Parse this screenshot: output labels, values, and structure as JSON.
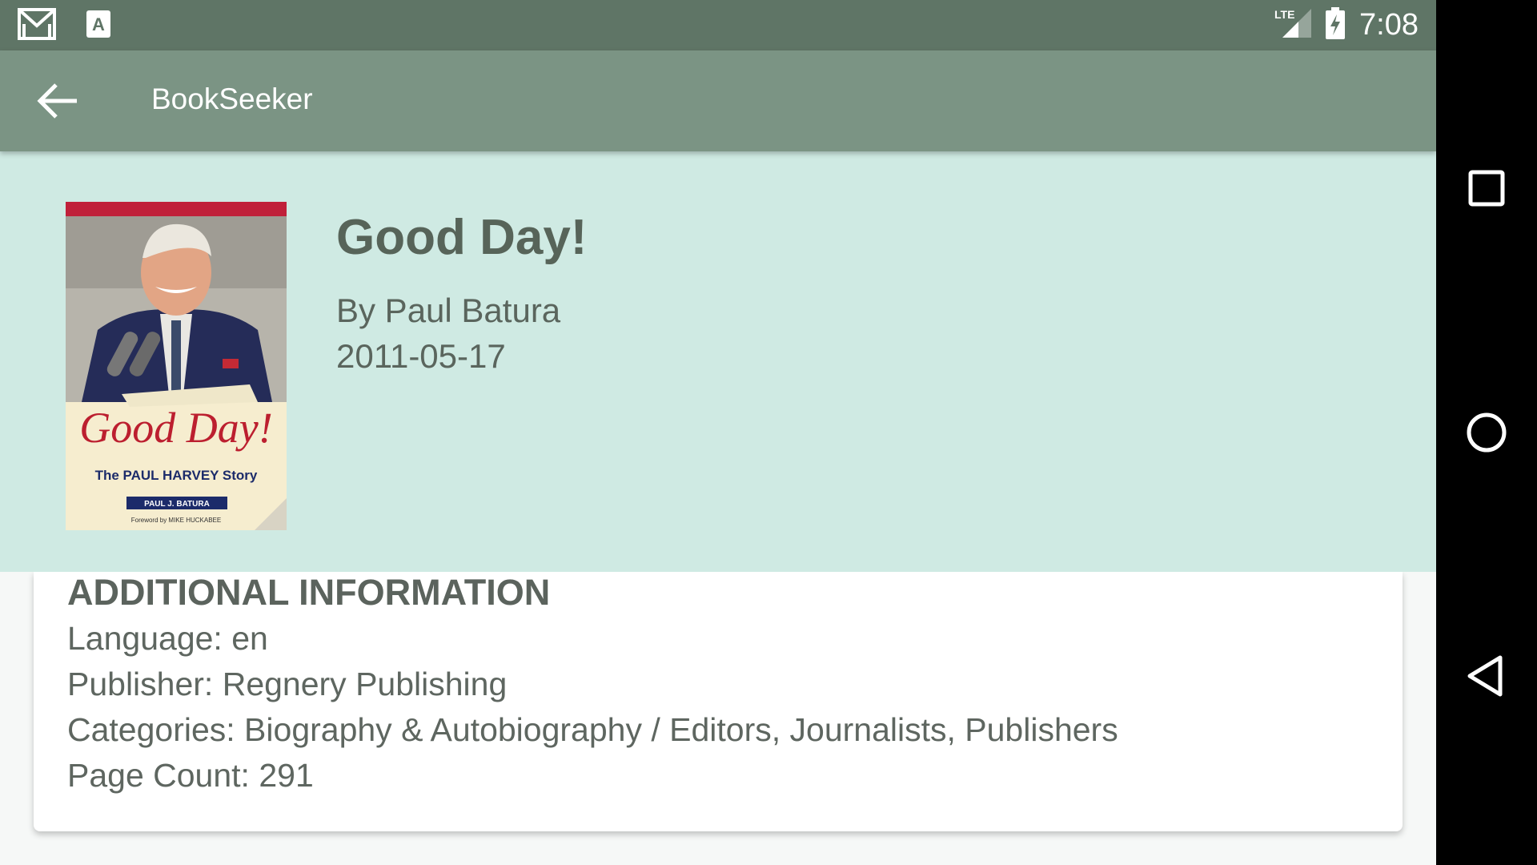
{
  "status_bar": {
    "time": "7:08",
    "network": "LTE",
    "icons": [
      "gmail-icon",
      "font-a-icon",
      "lte-signal-icon",
      "battery-charging-icon"
    ]
  },
  "app_bar": {
    "title": "BookSeeker",
    "back_icon": "arrow-left-icon"
  },
  "book": {
    "title": "Good Day!",
    "author": "By Paul Batura",
    "published": "2011-05-17",
    "cover": {
      "title_script": "Good Day!",
      "subtitle": "The PAUL HARVEY Story",
      "author": "PAUL J. BATURA",
      "foreword": "Foreword by MIKE HUCKABEE"
    }
  },
  "additional_info": {
    "heading": "ADDITIONAL INFORMATION",
    "language": "Language: en",
    "publisher": "Publisher: Regnery Publishing",
    "categories": "Categories: Biography & Autobiography / Editors, Journalists, Publishers",
    "page_count": "Page Count: 291"
  },
  "nav_bar": {
    "icons": [
      "recents-square-icon",
      "home-circle-icon",
      "back-triangle-icon"
    ]
  },
  "colors": {
    "status_bar": "#5f7566",
    "app_bar": "#7b9484",
    "header_panel": "#cfeae3",
    "card": "#ffffff",
    "nav_bar": "#000000"
  }
}
